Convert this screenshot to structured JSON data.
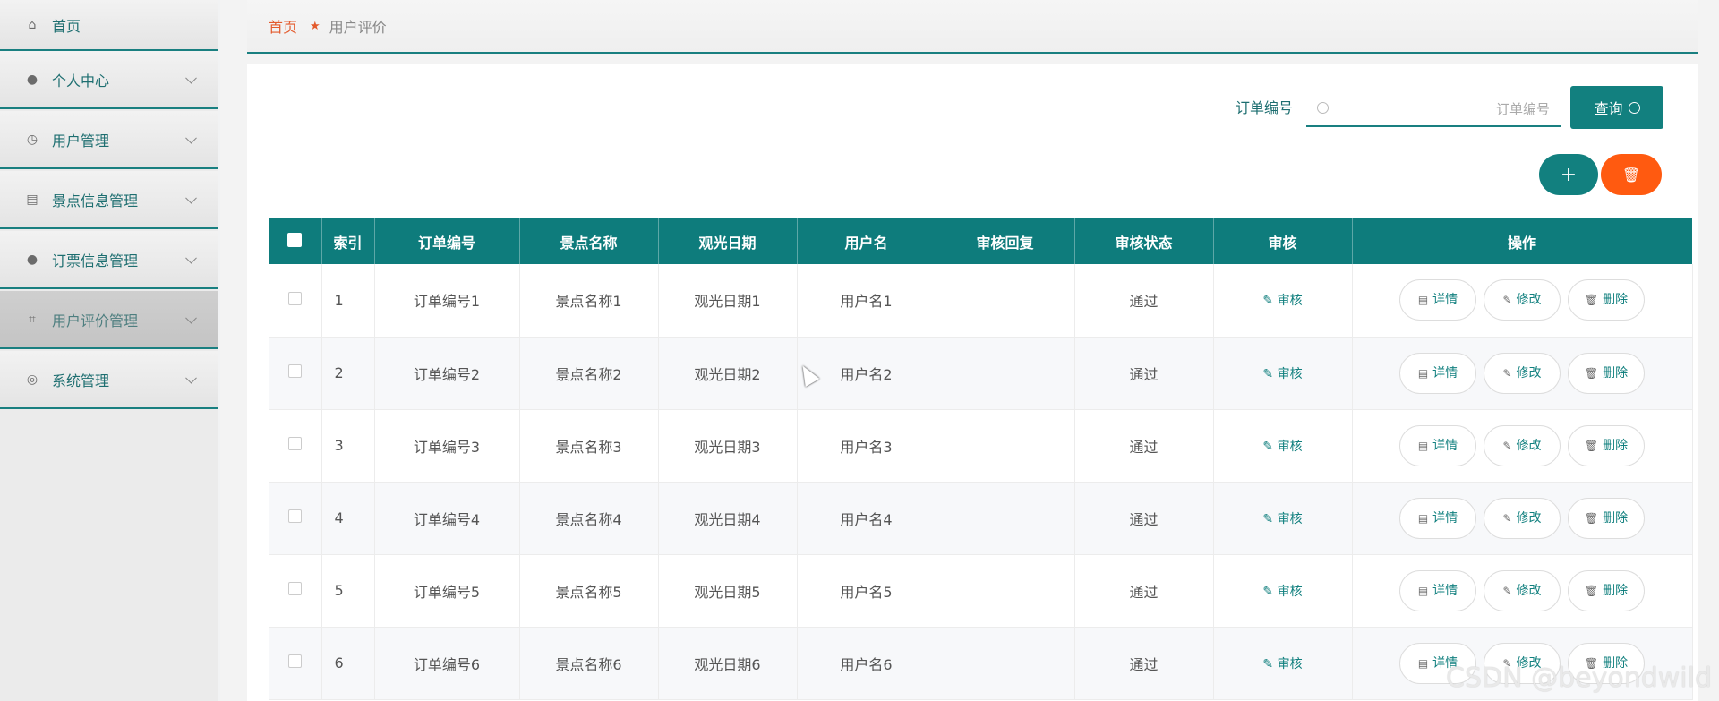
{
  "sidebar": {
    "items": [
      {
        "label": "首页",
        "icon": "home-icon",
        "glyph": "⌂",
        "has_chevron": false
      },
      {
        "label": "个人中心",
        "icon": "user-icon",
        "glyph": "●",
        "has_chevron": true
      },
      {
        "label": "用户管理",
        "icon": "clock-icon",
        "glyph": "◷",
        "has_chevron": true
      },
      {
        "label": "景点信息管理",
        "icon": "clipboard-icon",
        "glyph": "▤",
        "has_chevron": true
      },
      {
        "label": "订票信息管理",
        "icon": "lightbulb-icon",
        "glyph": "●",
        "has_chevron": true
      },
      {
        "label": "用户评价管理",
        "icon": "crop-icon",
        "glyph": "⌗",
        "has_chevron": true,
        "active": true
      },
      {
        "label": "系统管理",
        "icon": "compass-icon",
        "glyph": "◎",
        "has_chevron": true
      }
    ]
  },
  "breadcrumb": {
    "home": "首页",
    "current": "用户评价"
  },
  "search": {
    "label": "订单编号",
    "placeholder": "订单编号",
    "value": "",
    "button_label": "查询"
  },
  "actions": {
    "add_label": "+",
    "delete_glyph": "🗑"
  },
  "table": {
    "columns": [
      "",
      "索引",
      "订单编号",
      "景点名称",
      "观光日期",
      "用户名",
      "审核回复",
      "审核状态",
      "审核",
      "操作"
    ],
    "audit_label": "审核",
    "ops": {
      "detail": "详情",
      "edit": "修改",
      "delete": "删除"
    },
    "rows": [
      {
        "index": "1",
        "order": "订单编号1",
        "spot": "景点名称1",
        "date": "观光日期1",
        "user": "用户名1",
        "reply": "",
        "status": "通过"
      },
      {
        "index": "2",
        "order": "订单编号2",
        "spot": "景点名称2",
        "date": "观光日期2",
        "user": "用户名2",
        "reply": "",
        "status": "通过"
      },
      {
        "index": "3",
        "order": "订单编号3",
        "spot": "景点名称3",
        "date": "观光日期3",
        "user": "用户名3",
        "reply": "",
        "status": "通过"
      },
      {
        "index": "4",
        "order": "订单编号4",
        "spot": "景点名称4",
        "date": "观光日期4",
        "user": "用户名4",
        "reply": "",
        "status": "通过"
      },
      {
        "index": "5",
        "order": "订单编号5",
        "spot": "景点名称5",
        "date": "观光日期5",
        "user": "用户名5",
        "reply": "",
        "status": "通过"
      },
      {
        "index": "6",
        "order": "订单编号6",
        "spot": "景点名称6",
        "date": "观光日期6",
        "user": "用户名6",
        "reply": "",
        "status": "通过"
      }
    ]
  },
  "colors": {
    "primary": "#12807f",
    "danger": "#ff5a10",
    "breadcrumb_home": "#e35a2c"
  },
  "watermark": "CSDN @beyondwild"
}
